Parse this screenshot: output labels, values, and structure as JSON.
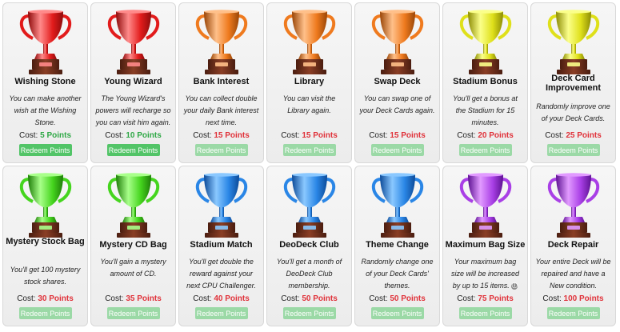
{
  "ui": {
    "cost_prefix": "Cost:",
    "redeem_label": "Redeem Points",
    "info_icon": "ⓘ"
  },
  "colors": {
    "affordable": "#2fa846",
    "unaffordable": "#e0323a",
    "button": "#52c467",
    "button_disabled": "#9bd9a6"
  },
  "rewards": [
    {
      "title": "Wishing Stone",
      "description": "You can make another wish at the Wishing Stone.",
      "cost": "5 Points",
      "affordable": true,
      "trophy_color": "red",
      "icon": "trophy-icon"
    },
    {
      "title": "Young Wizard",
      "description": "The Young Wizard's powers will recharge so you can visit him again.",
      "cost": "10 Points",
      "affordable": true,
      "trophy_color": "red",
      "icon": "trophy-icon"
    },
    {
      "title": "Bank Interest",
      "description": "You can collect double your daily Bank interest next time.",
      "cost": "15 Points",
      "affordable": false,
      "trophy_color": "orange",
      "icon": "trophy-icon"
    },
    {
      "title": "Library",
      "description": "You can visit the Library again.",
      "cost": "15 Points",
      "affordable": false,
      "trophy_color": "orange",
      "icon": "trophy-icon"
    },
    {
      "title": "Swap Deck",
      "description": "You can swap one of your Deck Cards again.",
      "cost": "15 Points",
      "affordable": false,
      "trophy_color": "orange",
      "icon": "trophy-icon"
    },
    {
      "title": "Stadium Bonus",
      "description": "You'll get a bonus at the Stadium for 15 minutes.",
      "cost": "20 Points",
      "affordable": false,
      "trophy_color": "yellow",
      "icon": "trophy-icon"
    },
    {
      "title": "Deck Card Improvement",
      "description": "Randomly improve one of your Deck Cards.",
      "cost": "25 Points",
      "affordable": false,
      "trophy_color": "yellow",
      "icon": "trophy-icon"
    },
    {
      "title": "Mystery Stock Bag",
      "description": "You'll get 100 mystery stock shares.",
      "cost": "30 Points",
      "affordable": false,
      "trophy_color": "green",
      "icon": "trophy-icon"
    },
    {
      "title": "Mystery CD Bag",
      "description": "You'll gain a mystery amount of CD.",
      "cost": "35 Points",
      "affordable": false,
      "trophy_color": "green",
      "icon": "trophy-icon"
    },
    {
      "title": "Stadium Match",
      "description": "You'll get double the reward against your next CPU Challenger.",
      "cost": "40 Points",
      "affordable": false,
      "trophy_color": "blue",
      "icon": "trophy-icon"
    },
    {
      "title": "DeoDeck Club",
      "description": "You'll get a month of DeoDeck Club membership.",
      "cost": "50 Points",
      "affordable": false,
      "trophy_color": "blue",
      "icon": "trophy-icon"
    },
    {
      "title": "Theme Change",
      "description": "Randomly change one of your Deck Cards' themes.",
      "cost": "50 Points",
      "affordable": false,
      "trophy_color": "blue",
      "icon": "trophy-icon"
    },
    {
      "title": "Maximum Bag Size",
      "description": "Your maximum bag size will be increased by up to 15 items.",
      "cost": "75 Points",
      "affordable": false,
      "trophy_color": "purple",
      "icon": "trophy-icon",
      "has_info": true
    },
    {
      "title": "Deck Repair",
      "description": "Your entire Deck will be repaired and have a New condition.",
      "cost": "100 Points",
      "affordable": false,
      "trophy_color": "purple",
      "icon": "trophy-icon"
    }
  ]
}
